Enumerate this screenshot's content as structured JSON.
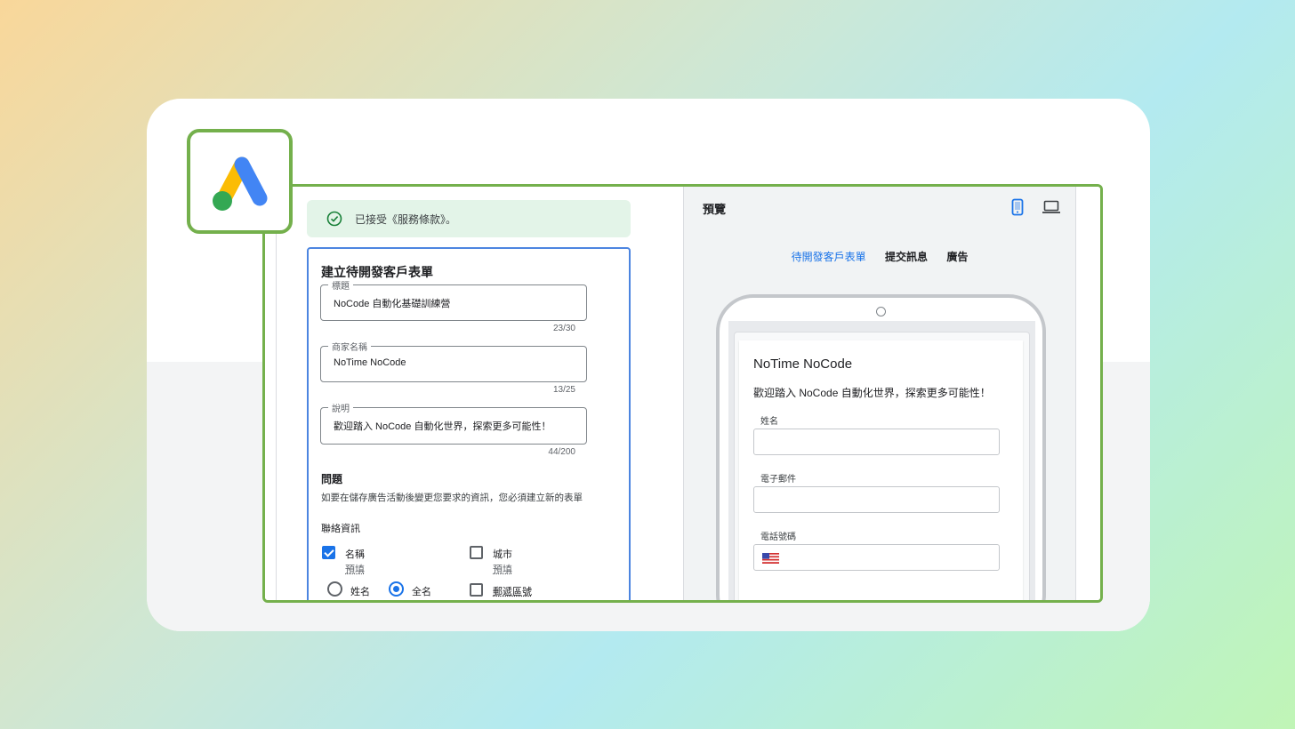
{
  "notice": {
    "text": "已接受《服務條款》。"
  },
  "form": {
    "title": "建立待開發客戶表單",
    "fields": [
      {
        "label": "標題",
        "value": "NoCode 自動化基礎訓練營",
        "counter": "23/30"
      },
      {
        "label": "商家名稱",
        "value": "NoTime NoCode",
        "counter": "13/25"
      },
      {
        "label": "說明",
        "value": "歡迎踏入 NoCode 自動化世界，探索更多可能性！",
        "counter": "44/200"
      }
    ],
    "questions_title": "問題",
    "questions_desc": "如要在儲存廣告活動後變更您要求的資訊，您必須建立新的表單",
    "contact_title": "聯絡資訊",
    "options": {
      "name": {
        "label": "名稱",
        "sub": "預填",
        "checked": true
      },
      "city": {
        "label": "城市",
        "sub": "預填",
        "checked": false
      },
      "first_name": {
        "label": "姓名",
        "selected": false
      },
      "full_name": {
        "label": "全名",
        "selected": true
      },
      "postal": {
        "label": "郵遞區號",
        "checked": false
      }
    }
  },
  "preview": {
    "title": "預覽",
    "tabs": [
      "待開發客戶表單",
      "提交訊息",
      "廣告"
    ],
    "active_tab": 0,
    "lead_form": {
      "business": "NoTime NoCode",
      "description": "歡迎踏入 NoCode 自動化世界，探索更多可能性！",
      "fields": [
        "姓名",
        "電子郵件",
        "電話號碼"
      ]
    }
  },
  "icons": [
    "google-ads-logo",
    "check-circle-icon",
    "phone-icon",
    "laptop-icon",
    "us-flag-icon"
  ],
  "colors": {
    "accent": "#1a73e8",
    "frame_border": "#74b04c",
    "notice_bg": "#e3f4e8"
  }
}
